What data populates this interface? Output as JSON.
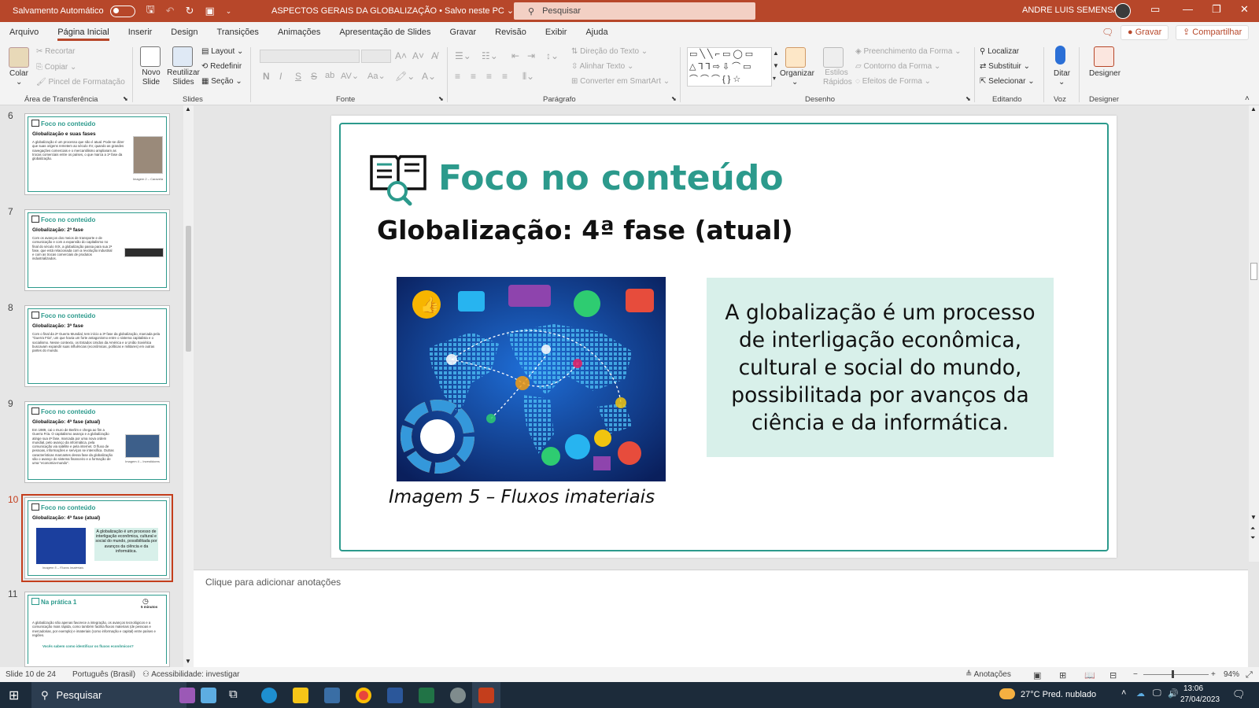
{
  "titlebar": {
    "autosave_label": "Salvamento Automático",
    "doc_title": "ASPECTOS GERAIS DA GLOBALIZAÇÃO • Salvo neste PC ⌄",
    "search_placeholder": "Pesquisar",
    "user_name": "ANDRE LUIS SEMENSATO"
  },
  "tabs": [
    "Arquivo",
    "Página Inicial",
    "Inserir",
    "Design",
    "Transições",
    "Animações",
    "Apresentação de Slides",
    "Gravar",
    "Revisão",
    "Exibir",
    "Ajuda"
  ],
  "tab_actions": {
    "record": "Gravar",
    "share": "Compartilhar"
  },
  "ribbon": {
    "clipboard": {
      "paste": "Colar",
      "cut": "Recortar",
      "copy": "Copiar",
      "format_painter": "Pincel de Formatação",
      "label": "Área de Transferência"
    },
    "slides": {
      "new_slide": "Novo Slide",
      "reuse": "Reutilizar Slides",
      "layout": "Layout",
      "reset": "Redefinir",
      "section": "Seção",
      "label": "Slides"
    },
    "font": {
      "label": "Fonte",
      "bold": "N",
      "italic": "I",
      "underline": "S",
      "strike": "S",
      "shadow": "ab"
    },
    "paragraph": {
      "text_direction": "Direção do Texto",
      "align_text": "Alinhar Texto",
      "smartart": "Converter em SmartArt",
      "label": "Parágrafo"
    },
    "drawing": {
      "arrange": "Organizar",
      "quick_styles": "Estilos Rápidos",
      "fill": "Preenchimento da Forma",
      "outline": "Contorno da Forma",
      "effects": "Efeitos de Forma",
      "label": "Desenho"
    },
    "editing": {
      "find": "Localizar",
      "replace": "Substituir",
      "select": "Selecionar",
      "label": "Editando"
    },
    "voice": {
      "dictate": "Ditar",
      "label": "Voz"
    },
    "designer": {
      "designer": "Designer",
      "label": "Designer"
    }
  },
  "thumbnails": [
    {
      "num": "6",
      "heading": "Foco no conteúdo",
      "subtitle": "Globalização e suas fases",
      "text": "A globalização é um processo que não é atual. Pode-se dizer que suas origens remetem ao século XV, quando as grandes navegações comerciais e o mercantilismo ampliaram as trocas comerciais entre os países, o que marca a 1ª fase da globalização.",
      "caption": "Imagem 2 – Caravela"
    },
    {
      "num": "7",
      "heading": "Foco no conteúdo",
      "subtitle": "Globalização: 2ª fase",
      "text": "Com os avanços dos meios de transporte e de comunicação e com a expansão do capitalismo no final do século XIX, a globalização passa para sua 2ª fase, que está relacionada com a revolução industrial e com as trocas comerciais de produtos industrializados.",
      "caption": ""
    },
    {
      "num": "8",
      "heading": "Foco no conteúdo",
      "subtitle": "Globalização: 3ª fase",
      "text": "Com o final da 2ª Guerra Mundial, tem início a 3ª fase da globalização, marcada pela \"Guerra Fria\", um que havia um forte antagonismo entre o sistema capitalista e o socialismo. Nesse contexto, os Estados Unidos da América e a União Soviética buscavam expandir suas influências (econômicas, políticas e militares) em outras partes do mundo.",
      "caption": ""
    },
    {
      "num": "9",
      "heading": "Foco no conteúdo",
      "subtitle": "Globalização: 4ª fase (atual)",
      "text": "Em 1989, cai o muro de Berlim e chega ao fim a Guerra Fria. O capitalismo avança e a globalização atinge sua 4ª fase, marcada por uma nova ordem mundial, pelo avanço da informática, pela comunicação via satélite e pela internet. O fluxo de pessoas, informações e serviços se intensifica. Outras características marcantes dessa fase da globalização são o avanço do sistema financeiro e a formação de uma \"economia-mundo\".",
      "caption": "Imagem 4 – Investidores"
    },
    {
      "num": "10",
      "heading": "Foco no conteúdo",
      "subtitle": "Globalização: 4ª fase (atual)",
      "text": "A globalização é um processo de interligação econômica, cultural e social do mundo, possibilitada por avanços da ciência e da informática.",
      "caption": "Imagem 5 – Fluxos imateriais"
    },
    {
      "num": "11",
      "heading": "Na prática 1",
      "subtitle": "5 minutos",
      "text": "A globalização não apenas favorece a integração, os avanços tecnológicos e a comunicação mais rápida, como também facilita fluxos materiais (de pessoas e mercadorias, por exemplo) e imateriais (como informação e capital) entre países e regiões.",
      "caption": "Vocês sabem como identificar os fluxos econômicos?"
    }
  ],
  "slide": {
    "title": "Foco no conteúdo",
    "subtitle": "Globalização: 4ª fase (atual)",
    "caption": "Imagem 5 – Fluxos imateriais",
    "body": "A globalização é um processo de interligação econômica, cultural e social do mundo, possibilitada por avanços da ciência e da informática."
  },
  "notes_placeholder": "Clique para adicionar anotações",
  "status": {
    "slide_info": "Slide 10 de 24",
    "language": "Português (Brasil)",
    "accessibility": "Acessibilidade: investigar",
    "notes": "Anotações",
    "zoom": "94%"
  },
  "taskbar": {
    "search": "Pesquisar",
    "weather": "27°C  Pred. nublado",
    "time": "13:06",
    "date": "27/04/2023"
  },
  "colors": {
    "accent": "#b7472a",
    "teal": "#2c9a8c",
    "box": "#d8f0ea"
  }
}
